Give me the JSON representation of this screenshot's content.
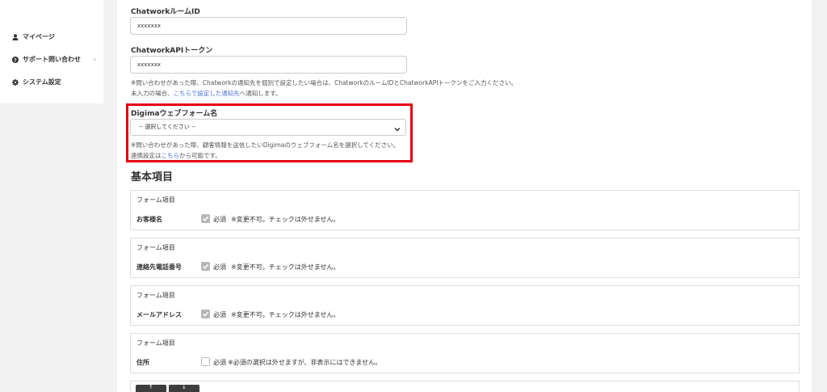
{
  "sidebar": {
    "items": [
      {
        "label": "マイページ",
        "icon": "user-icon"
      },
      {
        "label": "サポート問い合わせ",
        "icon": "help-circle-icon",
        "chevron": "›"
      },
      {
        "label": "システム設定",
        "icon": "gear-icon"
      }
    ]
  },
  "chatwork": {
    "room_label": "ChatworkルームID",
    "room_value": "xxxxxxx",
    "api_label": "ChatworkAPIトークン",
    "api_value": "xxxxxxx",
    "note_line1": "※問い合わせがあった際、Chatworkの通知先を個別で設定したい場合は、ChatworkのルームIDとChatworkAPIトークンをご入力ください。",
    "note_line2_pre": "未入力の場合、",
    "note_line2_link": "こちらで設定した通知先",
    "note_line2_post": "へ通知します。"
  },
  "digima": {
    "label": "Digimaウェブフォーム名",
    "select_value": "-- 選択してください --",
    "note_line1": "※問い合わせがあった際、顧客情報を送信したいDigimaのウェブフォーム名を選択してください。",
    "note_line2_pre": "連携設定は",
    "note_line2_link": "こちら",
    "note_line2_post": "から可能です。"
  },
  "basic": {
    "title": "基本項目",
    "cards": [
      {
        "head": "フォーム項目",
        "name": "お客様名",
        "required_label": "必須",
        "checked": true,
        "message": "※変更不可。チェックは外せません。"
      },
      {
        "head": "フォーム項目",
        "name": "連絡先電話番号",
        "required_label": "必須",
        "checked": true,
        "message": "※変更不可。チェックは外せません。"
      },
      {
        "head": "フォーム項目",
        "name": "メールアドレス",
        "required_label": "必須",
        "checked": true,
        "message": "※変更不可。チェックは外せません。"
      },
      {
        "head": "フォーム項目",
        "name": "住所",
        "required_label": "必須",
        "checked": false,
        "message": "※必須の選択は外せますが、非表示にはできません。"
      }
    ]
  },
  "buttons": [
    "↑",
    "↓"
  ],
  "colors": {
    "highlight": "#e50012",
    "link": "#4a6fd4",
    "checkbox_disabled": "#b7b7b7",
    "button_dark": "#3d3d3d"
  }
}
